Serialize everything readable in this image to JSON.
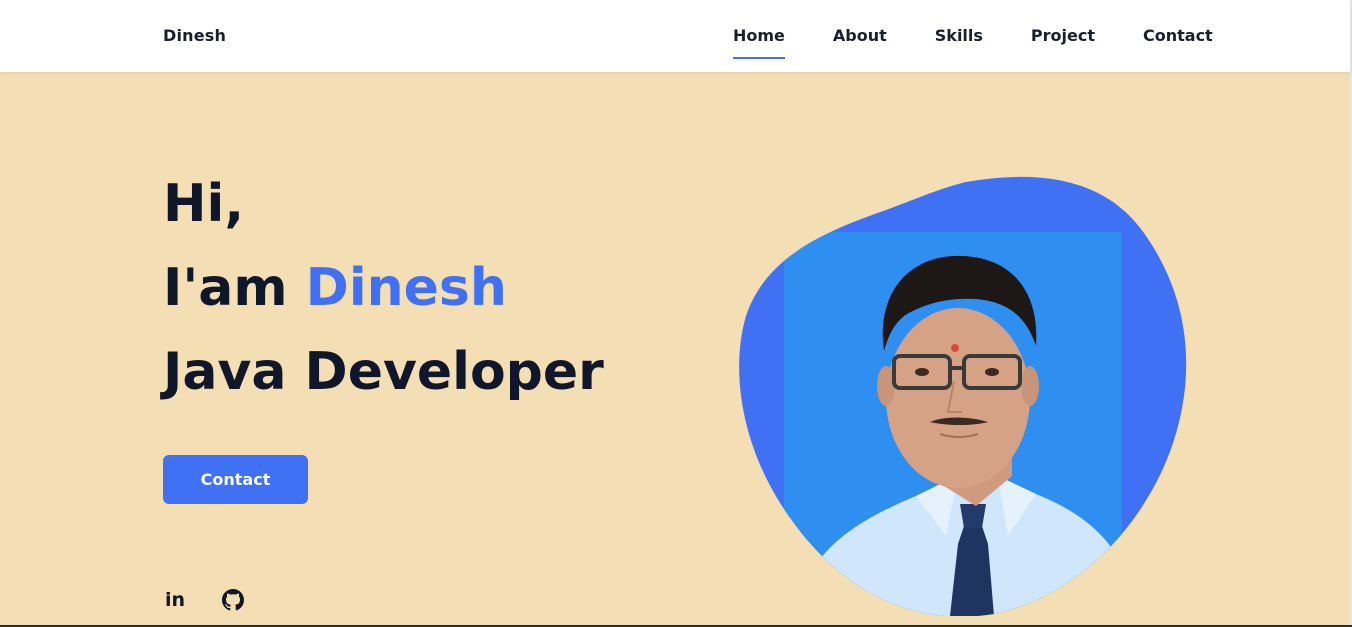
{
  "header": {
    "logo": "Dinesh",
    "nav": [
      {
        "label": "Home",
        "active": true
      },
      {
        "label": "About",
        "active": false
      },
      {
        "label": "Skills",
        "active": false
      },
      {
        "label": "Project",
        "active": false
      },
      {
        "label": "Contact",
        "active": false
      }
    ]
  },
  "hero": {
    "greeting": "Hi,",
    "intro_prefix": "I'am",
    "name": "Dinesh",
    "role": "Java Developer",
    "contact_button": "Contact"
  },
  "social": {
    "linkedin_label": "in",
    "icons": [
      "linkedin-icon",
      "github-icon"
    ]
  },
  "profile": {
    "image_alt": "Profile photo of Dinesh"
  },
  "colors": {
    "accent": "#4070f4",
    "hero_background": "#f4deb3",
    "heading": "#10172a",
    "photo_background": "#2f8ff0"
  }
}
